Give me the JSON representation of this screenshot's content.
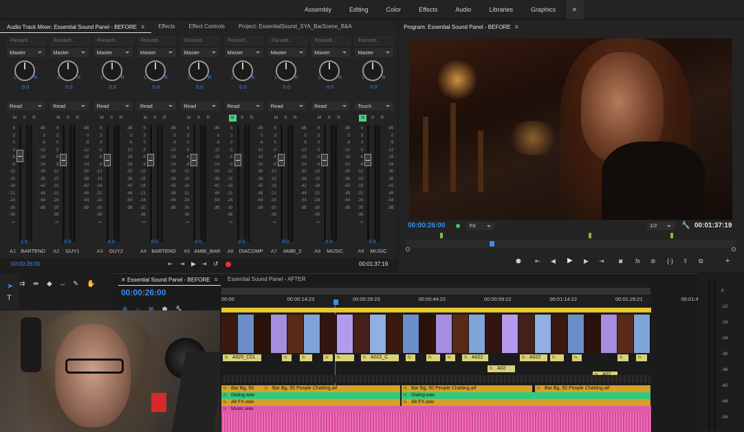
{
  "workspaces": [
    "Assembly",
    "Editing",
    "Color",
    "Effects",
    "Audio",
    "Libraries",
    "Graphics"
  ],
  "workspace_more": "»",
  "mixer": {
    "tabs": [
      "Audio Track Mixer: Essential Sound Panel - BEFORE",
      "Effects",
      "Effect Controls",
      "Project: EssentialSound_SYA_BarScene_B&A"
    ],
    "fx_label": "Focusrit...",
    "scale": [
      "6",
      "3",
      "0",
      "-3",
      "-6",
      "-9",
      "-12",
      "-15",
      "-18",
      "-21",
      "-24",
      "-30",
      "-36",
      "-∞"
    ],
    "meter_scale": [
      "dB",
      "0",
      "-6",
      "-12",
      "-18",
      "-24",
      "-30",
      "-36",
      "-42",
      "-48",
      "-54",
      "dB"
    ],
    "strips": [
      {
        "send": "Master",
        "pan": "0.0",
        "mode": "Read",
        "vol": "1.5",
        "id": "A1",
        "name": "BARTEND",
        "m": false,
        "fader": 0.3
      },
      {
        "send": "Master",
        "pan": "0.0",
        "mode": "Read",
        "vol": "0.0",
        "id": "A2",
        "name": "GUY1",
        "m": false,
        "fader": 0.35
      },
      {
        "send": "Master",
        "pan": "0.0",
        "mode": "Read",
        "vol": "0.0",
        "id": "A3",
        "name": "GUY2",
        "m": false,
        "fader": 0.35
      },
      {
        "send": "Master",
        "pan": "0.0",
        "mode": "Read",
        "vol": "0.0",
        "id": "A4",
        "name": "BARTEND",
        "m": false,
        "fader": 0.35
      },
      {
        "send": "Master",
        "pan": "0.0",
        "mode": "Read",
        "vol": "0.0",
        "id": "A5",
        "name": "AMBI_BAR",
        "m": false,
        "fader": 0.35
      },
      {
        "send": "Master",
        "pan": "0.0",
        "mode": "Read",
        "vol": "0.0",
        "id": "A6",
        "name": "DIACOMP",
        "m": true,
        "fader": 0.35
      },
      {
        "send": "Master",
        "pan": "0.0",
        "mode": "Read",
        "vol": "0.0",
        "id": "A7",
        "name": "AMBI_2",
        "m": false,
        "fader": 0.35
      },
      {
        "send": "Master",
        "pan": "0.0",
        "mode": "Read",
        "vol": "0.0",
        "id": "A8",
        "name": "MUSIC",
        "m": false,
        "fader": 0.35
      },
      {
        "send": "Master",
        "pan": "0.0",
        "mode": "Touch",
        "vol": "0.0",
        "id": "A9",
        "name": "MUSIC",
        "m": true,
        "fader": 0.35
      }
    ],
    "timecode_in": "00:00:26:00",
    "timecode_out": "00:01:37:19"
  },
  "program": {
    "title": "Program: Essential Sound Panel - BEFORE",
    "timecode": "00:00:26:00",
    "fit": "Fit",
    "res": "1/2",
    "duration": "00:01:37:19"
  },
  "timeline": {
    "tabs": [
      "Essential Sound Panel - BEFORE",
      "Essential Sound Panel - AFTER"
    ],
    "timecode": "00:00:26:00",
    "ruler": [
      "00:00",
      "00:00:14:23",
      "00:00:29:23",
      "00:00:44:22",
      "00:00:59:22",
      "00:01:14:22",
      "00:01:29:21",
      "00:01:4"
    ],
    "clips_v": [
      "A020_C01",
      "A022_C",
      "A022",
      "A022",
      "A02",
      "A02"
    ],
    "audio": [
      {
        "label": "Bar Bg, 50",
        "color": "#d6a12a"
      },
      {
        "label": "Bar Bg, 50 People Chatting.aif",
        "color": "#d6a12a"
      },
      {
        "label": "Bar Bg, 50 People Chatting.aif",
        "color": "#d6a12a"
      },
      {
        "label": "Bar Bg, 50 People Chatting.aif",
        "color": "#d6a12a"
      },
      {
        "label": "Dialog.wav",
        "color": "#37c77a"
      },
      {
        "label": "Dialog.wav",
        "color": "#37c77a"
      },
      {
        "label": "Alt FX.wav",
        "color": "#d6a12a"
      },
      {
        "label": "Alt FX.wav",
        "color": "#d6a12a"
      },
      {
        "label": "Music.wav",
        "color": "#e05ca8"
      }
    ]
  },
  "vmeter_scale": [
    "0",
    "-12",
    "-18",
    "-24",
    "-30",
    "-36",
    "-42",
    "-48",
    "-54"
  ]
}
